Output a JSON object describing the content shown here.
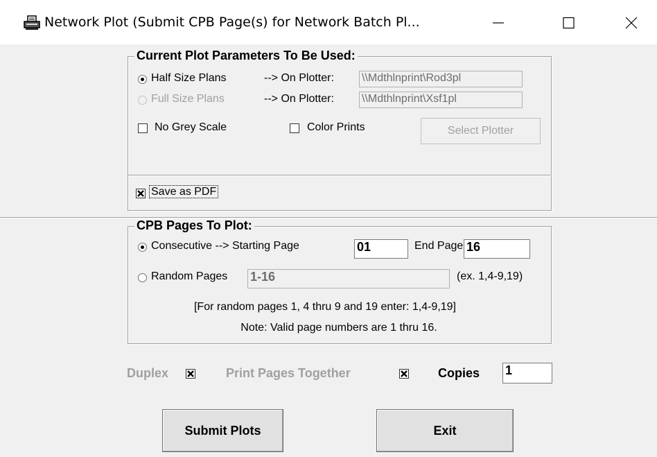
{
  "window": {
    "title": "Network Plot (Submit CPB Page(s) for Network Batch Pl...",
    "minimize_icon": "minimize-icon",
    "maximize_icon": "maximize-icon",
    "close_icon": "close-icon",
    "app_icon": "printer-icon"
  },
  "params": {
    "legend": "Current Plot Parameters To Be Used:",
    "half_label": "Half Size Plans",
    "half_plotter_label": "--> On Plotter:",
    "half_plotter_value": "\\\\Mdthlnprint\\Rod3pl",
    "full_label": "Full Size Plans",
    "full_plotter_label": "--> On Plotter:",
    "full_plotter_value": "\\\\Mdthlnprint\\Xsf1pl",
    "no_grey_label": "No Grey Scale",
    "color_prints_label": "Color Prints",
    "select_plotter_label": "Select Plotter",
    "save_pdf_label": "Save as PDF"
  },
  "pages": {
    "legend": "CPB Pages To Plot:",
    "consecutive_label": "Consecutive --> Starting Page",
    "start_value": "01",
    "end_label": "End Page",
    "end_value": "16",
    "random_label": "Random Pages",
    "random_value": "1-16",
    "random_example": "(ex. 1,4-9,19)",
    "hint": "[For random pages 1, 4 thru 9 and 19 enter:  1,4-9,19]",
    "note": "Note:  Valid page numbers are 1 thru 16."
  },
  "options": {
    "duplex_label": "Duplex",
    "together_label": "Print Pages Together",
    "copies_label": "Copies",
    "copies_value": "1"
  },
  "actions": {
    "submit_label": "Submit Plots",
    "exit_label": "Exit"
  }
}
